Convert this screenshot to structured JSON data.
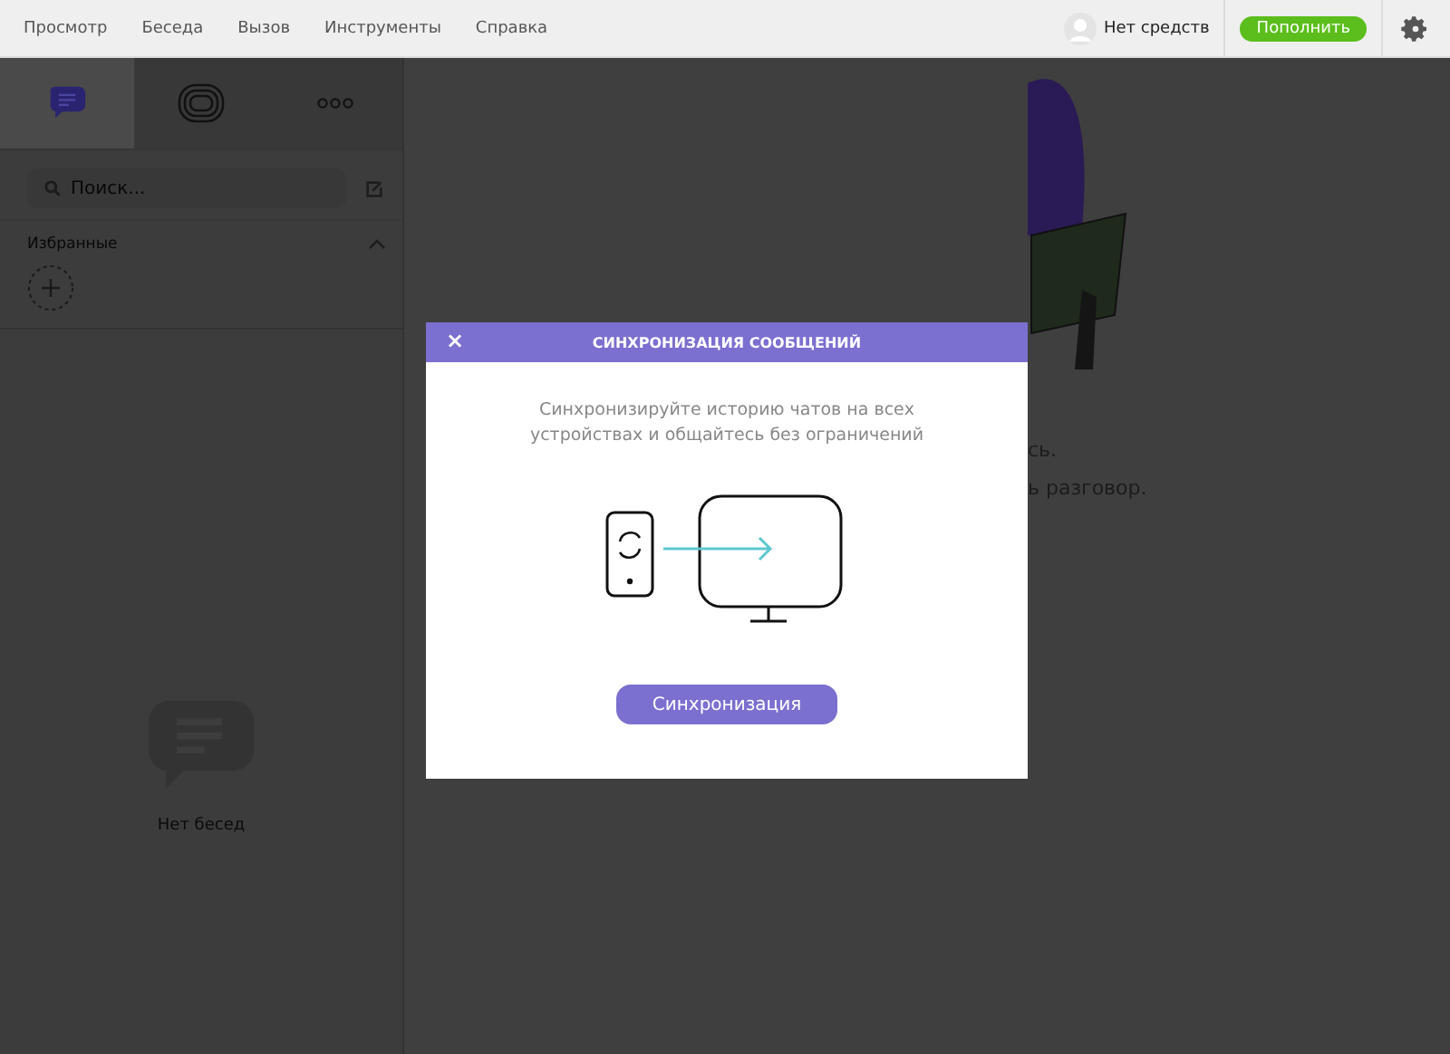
{
  "menu": [
    "Просмотр",
    "Беседа",
    "Вызов",
    "Инструменты",
    "Справка"
  ],
  "account": {
    "balance": "Нет средств",
    "topup_button": "Пополнить"
  },
  "sidebar": {
    "tabs": [
      {
        "kind": "chats",
        "selected": true
      },
      {
        "kind": "calls",
        "selected": false
      },
      {
        "kind": "more",
        "selected": false
      }
    ],
    "search": {
      "placeholder": "Поиск..."
    },
    "favorites": {
      "label": "Избранные",
      "expanded": true
    },
    "empty_text": "Нет бесед"
  },
  "background_texts": [
    "сь.",
    "ь разговор."
  ],
  "dialog": {
    "close": "×",
    "title": "СИНХРОНИЗАЦИЯ СООБЩЕНИЙ",
    "description": "Синхронизируйте историю чатов на всех устройствах и общайтесь без ограничений",
    "button": "Синхронизация"
  }
}
